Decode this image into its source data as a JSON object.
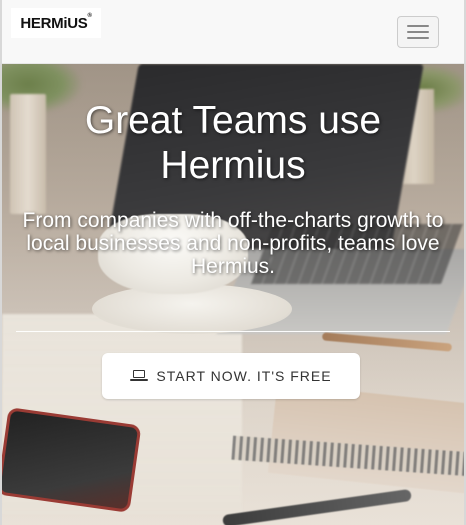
{
  "brand": {
    "logo_text": "HERMiUS",
    "logo_mark": "®"
  },
  "nav": {
    "toggle_icon": "hamburger-icon"
  },
  "hero": {
    "title": "Great Teams use Hermius",
    "subtitle_line1": "From companies with off-the-charts growth to",
    "subtitle_line2": "local businesses and non-profits, teams love Hermius.",
    "cta_label": "START NOW. IT'S FREE",
    "cta_icon": "laptop-icon"
  }
}
